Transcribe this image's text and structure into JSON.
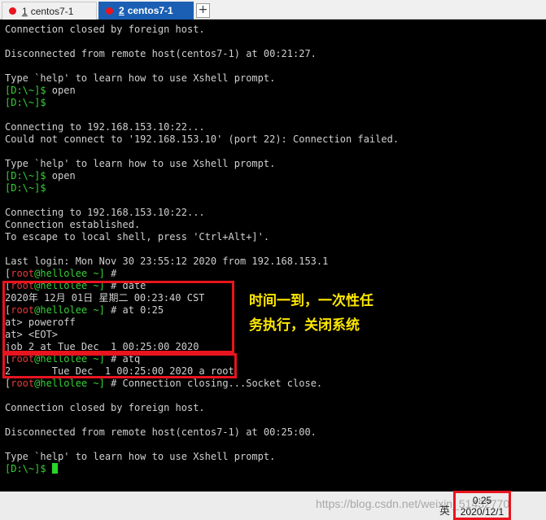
{
  "tabs": [
    {
      "number": "1",
      "label": "centos7-1",
      "active": false
    },
    {
      "number": "2",
      "label": "centos7-1",
      "active": true
    }
  ],
  "new_tab_symbol": "+",
  "terminal_lines": [
    {
      "parts": [
        {
          "t": "Connection closed by foreign host.",
          "c": "w"
        }
      ]
    },
    {
      "parts": []
    },
    {
      "parts": [
        {
          "t": "Disconnected from remote host(centos7-1) at 00:21:27.",
          "c": "w"
        }
      ]
    },
    {
      "parts": []
    },
    {
      "parts": [
        {
          "t": "Type `help' to learn how to use Xshell prompt.",
          "c": "w"
        }
      ]
    },
    {
      "parts": [
        {
          "t": "[D:\\~]$ ",
          "c": "g"
        },
        {
          "t": "open",
          "c": "w"
        }
      ]
    },
    {
      "parts": [
        {
          "t": "[D:\\~]$",
          "c": "g"
        }
      ]
    },
    {
      "parts": []
    },
    {
      "parts": [
        {
          "t": "Connecting to 192.168.153.10:22...",
          "c": "w"
        }
      ]
    },
    {
      "parts": [
        {
          "t": "Could not connect to '192.168.153.10' (port 22): Connection failed.",
          "c": "w"
        }
      ]
    },
    {
      "parts": []
    },
    {
      "parts": [
        {
          "t": "Type `help' to learn how to use Xshell prompt.",
          "c": "w"
        }
      ]
    },
    {
      "parts": [
        {
          "t": "[D:\\~]$ ",
          "c": "g"
        },
        {
          "t": "open",
          "c": "w"
        }
      ]
    },
    {
      "parts": [
        {
          "t": "[D:\\~]$",
          "c": "g"
        }
      ]
    },
    {
      "parts": []
    },
    {
      "parts": [
        {
          "t": "Connecting to 192.168.153.10:22...",
          "c": "w"
        }
      ]
    },
    {
      "parts": [
        {
          "t": "Connection established.",
          "c": "w"
        }
      ]
    },
    {
      "parts": [
        {
          "t": "To escape to local shell, press 'Ctrl+Alt+]'.",
          "c": "w"
        }
      ]
    },
    {
      "parts": []
    },
    {
      "parts": [
        {
          "t": "Last login: Mon Nov 30 23:55:12 2020 from 192.168.153.1",
          "c": "w"
        }
      ]
    },
    {
      "parts": [
        {
          "t": "[",
          "c": "w"
        },
        {
          "t": "root",
          "c": "r"
        },
        {
          "t": "@hellolee ~] ",
          "c": "g"
        },
        {
          "t": "#",
          "c": "w"
        }
      ]
    },
    {
      "parts": [
        {
          "t": "[",
          "c": "w"
        },
        {
          "t": "root",
          "c": "r"
        },
        {
          "t": "@hellolee ~] ",
          "c": "g"
        },
        {
          "t": "# date",
          "c": "w"
        }
      ]
    },
    {
      "parts": [
        {
          "t": "2020年 12月 01日 星期二 00:23:40 CST",
          "c": "w"
        }
      ]
    },
    {
      "parts": [
        {
          "t": "[",
          "c": "w"
        },
        {
          "t": "root",
          "c": "r"
        },
        {
          "t": "@hellolee ~] ",
          "c": "g"
        },
        {
          "t": "# at 0:25",
          "c": "w"
        }
      ]
    },
    {
      "parts": [
        {
          "t": "at> poweroff",
          "c": "w"
        }
      ]
    },
    {
      "parts": [
        {
          "t": "at> <EOT>",
          "c": "w"
        }
      ]
    },
    {
      "parts": [
        {
          "t": "job 2 at Tue Dec  1 00:25:00 2020",
          "c": "w"
        }
      ]
    },
    {
      "parts": [
        {
          "t": "[",
          "c": "w"
        },
        {
          "t": "root",
          "c": "r"
        },
        {
          "t": "@hellolee ~] ",
          "c": "g"
        },
        {
          "t": "# atq",
          "c": "w"
        }
      ]
    },
    {
      "parts": [
        {
          "t": "2       Tue Dec  1 00:25:00 2020 a root",
          "c": "w"
        }
      ]
    },
    {
      "parts": [
        {
          "t": "[",
          "c": "w"
        },
        {
          "t": "root",
          "c": "r"
        },
        {
          "t": "@hellolee ~] ",
          "c": "g"
        },
        {
          "t": "# Connection closing...Socket close.",
          "c": "w"
        }
      ]
    },
    {
      "parts": []
    },
    {
      "parts": [
        {
          "t": "Connection closed by foreign host.",
          "c": "w"
        }
      ]
    },
    {
      "parts": []
    },
    {
      "parts": [
        {
          "t": "Disconnected from remote host(centos7-1) at 00:25:00.",
          "c": "w"
        }
      ]
    },
    {
      "parts": []
    },
    {
      "parts": [
        {
          "t": "Type `help' to learn how to use Xshell prompt.",
          "c": "w"
        }
      ]
    },
    {
      "parts": [
        {
          "t": "[D:\\~]$ ",
          "c": "g"
        }
      ],
      "cursor": true
    }
  ],
  "annotation": {
    "line1": "时间一到，一次性任",
    "line2": "务执行，关闭系统"
  },
  "taskbar": {
    "watermark": "https://blog.csdn.net/weixin_51432770",
    "tray_ime": "英",
    "clock_time": "0:25",
    "clock_date": "2020/12/1"
  },
  "colors": {
    "prompt_green": "#37d137",
    "root_red": "#e83a3a",
    "highlight_red": "#e8141e",
    "annotation_yellow": "#ffe800",
    "active_tab_blue": "#1a5fb4"
  }
}
